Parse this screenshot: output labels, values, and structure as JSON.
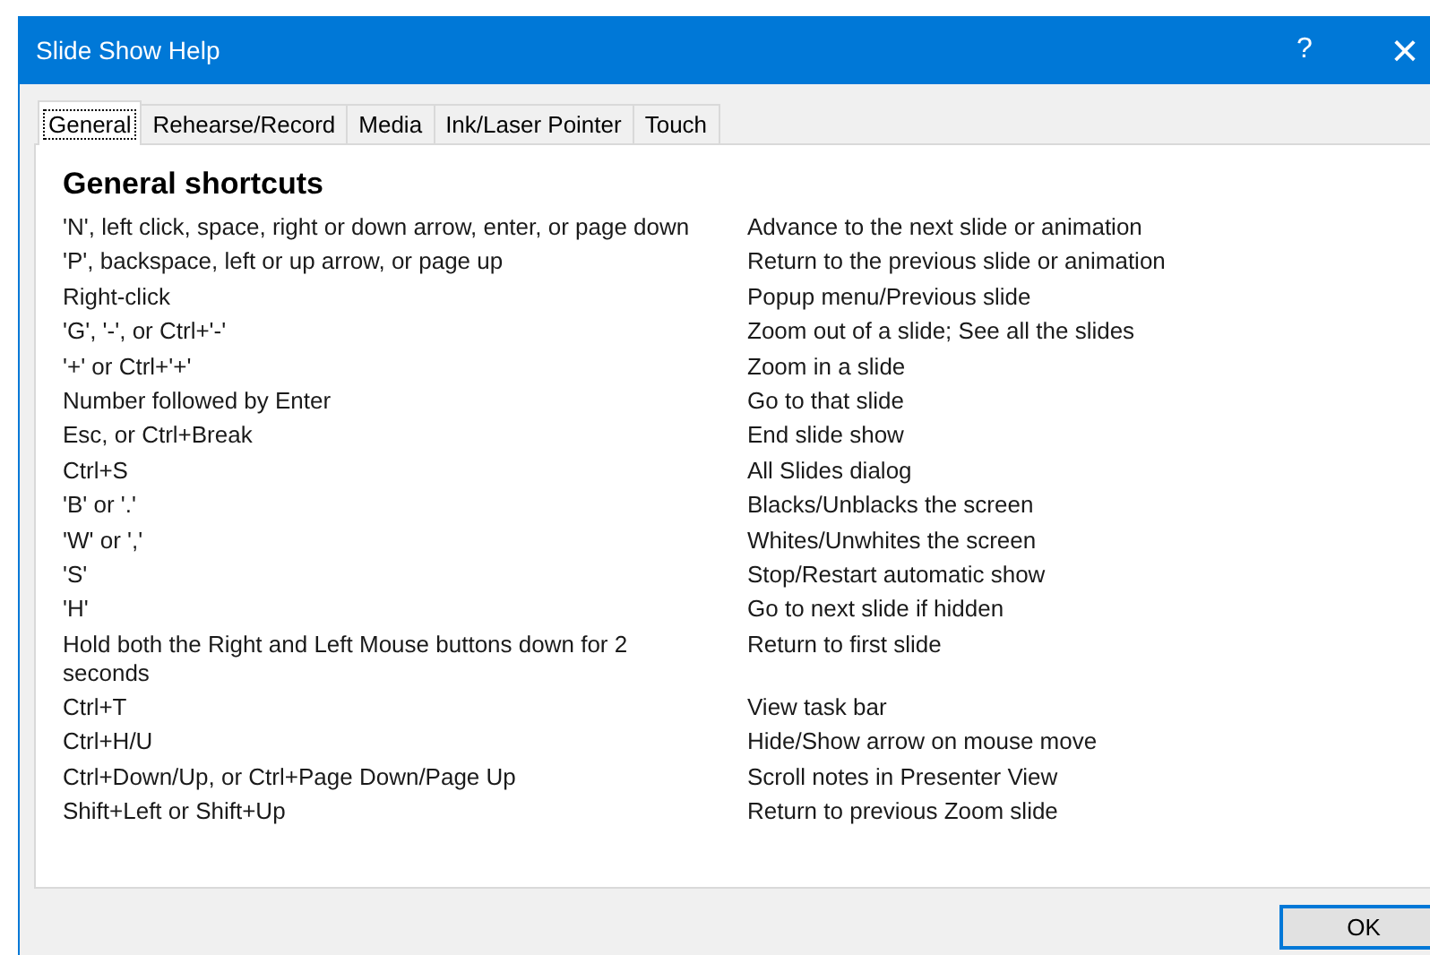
{
  "window": {
    "title": "Slide Show Help",
    "help": "?",
    "close": "×"
  },
  "tabs": [
    {
      "label": "General",
      "selected": true
    },
    {
      "label": "Rehearse/Record",
      "selected": false
    },
    {
      "label": "Media",
      "selected": false
    },
    {
      "label": "Ink/Laser Pointer",
      "selected": false
    },
    {
      "label": "Touch",
      "selected": false
    }
  ],
  "section_title": "General shortcuts",
  "shortcuts": [
    {
      "keys": "'N', left click, space, right or down arrow, enter, or page down",
      "action": "Advance to the next slide or animation"
    },
    {
      "keys": "'P', backspace, left or up arrow, or page up",
      "action": "Return to the previous slide or animation"
    },
    {
      "keys": "Right-click",
      "action": "Popup menu/Previous slide"
    },
    {
      "keys": "'G', '-', or Ctrl+'-'",
      "action": "Zoom out of a slide; See all the slides"
    },
    {
      "keys": "'+' or Ctrl+'+'",
      "action": "Zoom in a slide"
    },
    {
      "keys": "Number followed by Enter",
      "action": "Go to that slide"
    },
    {
      "keys": "Esc, or Ctrl+Break",
      "action": "End slide show"
    },
    {
      "keys": "Ctrl+S",
      "action": "All Slides dialog"
    },
    {
      "keys": "'B' or '.'",
      "action": "Blacks/Unblacks the screen"
    },
    {
      "keys": "'W' or ','",
      "action": "Whites/Unwhites the screen"
    },
    {
      "keys": "'S'",
      "action": "Stop/Restart automatic show"
    },
    {
      "keys": "'H'",
      "action": "Go to next slide if hidden"
    },
    {
      "keys": "Hold both the Right and Left Mouse buttons down for 2 seconds",
      "action": "Return to first slide"
    },
    {
      "keys": "Ctrl+T",
      "action": "View task bar"
    },
    {
      "keys": "Ctrl+H/U",
      "action": "Hide/Show arrow on mouse move"
    },
    {
      "keys": "Ctrl+Down/Up, or Ctrl+Page Down/Page Up",
      "action": "Scroll notes in Presenter View"
    },
    {
      "keys": "Shift+Left or Shift+Up",
      "action": "Return to previous Zoom slide"
    }
  ],
  "buttons": [
    {
      "label": "OK"
    }
  ]
}
